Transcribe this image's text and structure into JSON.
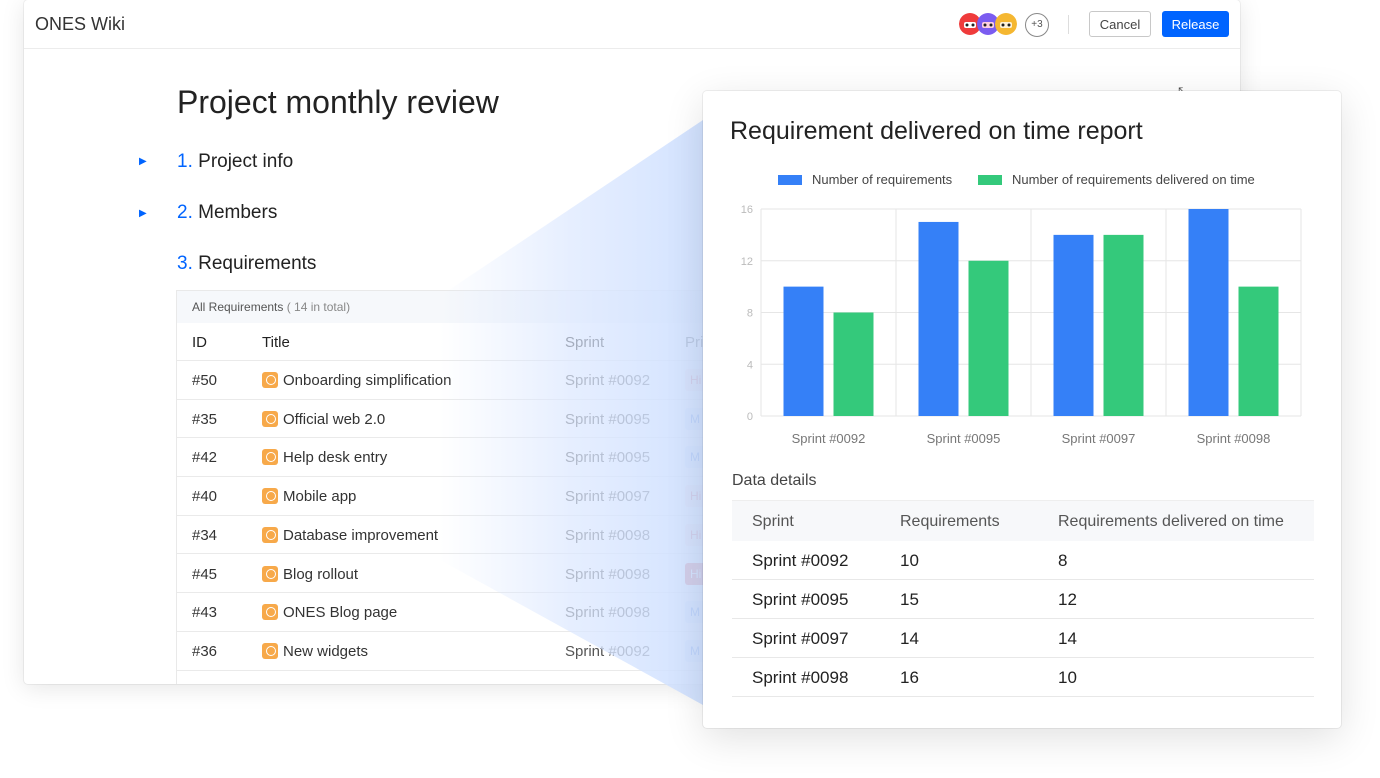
{
  "app": {
    "title": "ONES Wiki"
  },
  "header": {
    "more_avatars": "+3",
    "cancel_label": "Cancel",
    "release_label": "Release",
    "expand_icon": "⤡"
  },
  "doc": {
    "title": "Project monthly review",
    "sections": [
      {
        "num": "1.",
        "label": "Project info"
      },
      {
        "num": "2.",
        "label": "Members"
      },
      {
        "num": "3.",
        "label": "Requirements"
      }
    ]
  },
  "requirements": {
    "caption": "All Requirements",
    "count": "( 14 in total)",
    "columns": {
      "id": "ID",
      "title": "Title",
      "sprint": "Sprint",
      "priority": "Pri"
    },
    "rows": [
      {
        "id": "#50",
        "title": "Onboarding simplification",
        "sprint": "Sprint #0092",
        "priority": "Hi"
      },
      {
        "id": "#35",
        "title": "Official web 2.0",
        "sprint": "Sprint #0095",
        "priority": "M"
      },
      {
        "id": "#42",
        "title": "Help desk entry",
        "sprint": "Sprint #0095",
        "priority": "M"
      },
      {
        "id": "#40",
        "title": "Mobile app",
        "sprint": "Sprint #0097",
        "priority": "Hi"
      },
      {
        "id": "#34",
        "title": "Database improvement",
        "sprint": "Sprint #0098",
        "priority": "Hi"
      },
      {
        "id": "#45",
        "title": "Blog rollout",
        "sprint": "Sprint #0098",
        "priority": "Hi"
      },
      {
        "id": "#43",
        "title": "ONES Blog page",
        "sprint": "Sprint #0098",
        "priority": "M"
      },
      {
        "id": "#36",
        "title": "New widgets",
        "sprint": "Sprint #0092",
        "priority": "M"
      }
    ],
    "priority_colors": {
      "Hi": "#fde8e8",
      "Hi-text": "#e0505a",
      "Hi-urgent": "#e5484d",
      "M": "#e4efff",
      "M-text": "#3d7be8"
    }
  },
  "report": {
    "title": "Requirement delivered on time report",
    "data_details_title": "Data details",
    "table_columns": [
      "Sprint",
      "Requirements",
      "Requirements delivered on time"
    ]
  },
  "chart_data": {
    "type": "bar",
    "title": "Requirement delivered on time report",
    "categories": [
      "Sprint #0092",
      "Sprint #0095",
      "Sprint #0097",
      "Sprint #0098"
    ],
    "series": [
      {
        "name": "Number of requirements",
        "values": [
          10,
          15,
          14,
          16
        ],
        "color": "#3580f7"
      },
      {
        "name": "Number of requirements delivered on time",
        "values": [
          8,
          12,
          14,
          10
        ],
        "color": "#34c97b"
      }
    ],
    "ylim": [
      0,
      16
    ],
    "yticks": [
      "0",
      "4",
      "8",
      "12",
      "16"
    ],
    "grid": true,
    "legend": "top"
  }
}
